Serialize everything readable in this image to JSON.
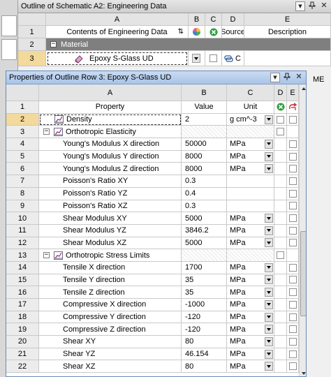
{
  "outline": {
    "title": "Outline of Schematic A2: Engineering Data",
    "columns": [
      "A",
      "B",
      "C",
      "D",
      "E"
    ],
    "header_row_num": "1",
    "headers": {
      "a": "Contents of Engineering Data",
      "d": "Source",
      "e": "Description"
    },
    "material_row_num": "2",
    "material_label": "Material",
    "epoxy_row_num": "3",
    "epoxy_label": "Epoxy S-Glass UD",
    "epoxy_source_partial": "C",
    "description_partial": "ME"
  },
  "properties": {
    "title": "Properties of Outline Row 3: Epoxy S-Glass UD",
    "columns": [
      "A",
      "B",
      "C",
      "D",
      "E"
    ],
    "header": {
      "num": "1",
      "property": "Property",
      "value": "Value",
      "unit": "Unit"
    },
    "rows": [
      {
        "num": "2",
        "kind": "top",
        "property": "Density",
        "value": "2",
        "unit": "g cm^-3"
      },
      {
        "num": "3",
        "kind": "cat",
        "property": "Orthotropic Elasticity",
        "value": "",
        "unit": ""
      },
      {
        "num": "4",
        "kind": "child",
        "property": "Young's Modulus X direction",
        "value": "50000",
        "unit": "MPa"
      },
      {
        "num": "5",
        "kind": "child",
        "property": "Young's Modulus Y direction",
        "value": "8000",
        "unit": "MPa"
      },
      {
        "num": "6",
        "kind": "child",
        "property": "Young's Modulus Z direction",
        "value": "8000",
        "unit": "MPa"
      },
      {
        "num": "7",
        "kind": "child",
        "property": "Poisson's Ratio XY",
        "value": "0.3",
        "unit": ""
      },
      {
        "num": "8",
        "kind": "child",
        "property": "Poisson's Ratio YZ",
        "value": "0.4",
        "unit": ""
      },
      {
        "num": "9",
        "kind": "child",
        "property": "Poisson's Ratio XZ",
        "value": "0.3",
        "unit": ""
      },
      {
        "num": "10",
        "kind": "child",
        "property": "Shear Modulus XY",
        "value": "5000",
        "unit": "MPa"
      },
      {
        "num": "11",
        "kind": "child",
        "property": "Shear Modulus YZ",
        "value": "3846.2",
        "unit": "MPa"
      },
      {
        "num": "12",
        "kind": "child",
        "property": "Shear Modulus XZ",
        "value": "5000",
        "unit": "MPa"
      },
      {
        "num": "13",
        "kind": "cat",
        "property": "Orthotropic Stress Limits",
        "value": "",
        "unit": ""
      },
      {
        "num": "14",
        "kind": "child",
        "property": "Tensile X direction",
        "value": "1700",
        "unit": "MPa"
      },
      {
        "num": "15",
        "kind": "child",
        "property": "Tensile Y direction",
        "value": "35",
        "unit": "MPa"
      },
      {
        "num": "16",
        "kind": "child",
        "property": "Tensile Z direction",
        "value": "35",
        "unit": "MPa"
      },
      {
        "num": "17",
        "kind": "child",
        "property": "Compressive X direction",
        "value": "-1000",
        "unit": "MPa"
      },
      {
        "num": "18",
        "kind": "child",
        "property": "Compressive Y direction",
        "value": "-120",
        "unit": "MPa"
      },
      {
        "num": "19",
        "kind": "child",
        "property": "Compressive Z direction",
        "value": "-120",
        "unit": "MPa"
      },
      {
        "num": "20",
        "kind": "child",
        "property": "Shear XY",
        "value": "80",
        "unit": "MPa"
      },
      {
        "num": "21",
        "kind": "child",
        "property": "Shear YZ",
        "value": "46.154",
        "unit": "MPa"
      },
      {
        "num": "22",
        "kind": "child",
        "property": "Shear XZ",
        "value": "80",
        "unit": "MPa"
      }
    ]
  },
  "colors": {
    "selection": "#f3d99b",
    "props_title": "#a9c4e8",
    "material_band": "#7f7f7f"
  },
  "icons": {
    "pin": "pin-icon",
    "close": "close-icon",
    "expand": "expand-minus-icon",
    "property": "property-chart-icon",
    "material": "material-book-icon"
  }
}
